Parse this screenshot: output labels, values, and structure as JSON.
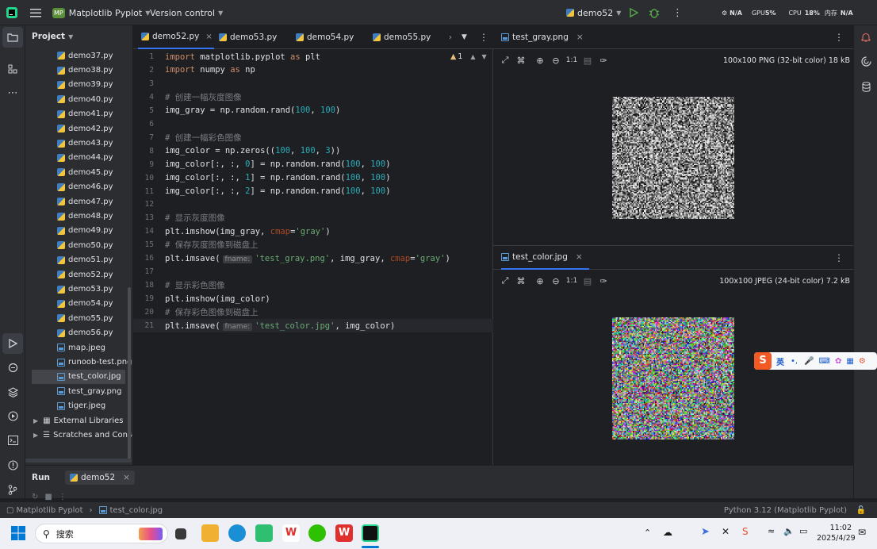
{
  "titlebar": {
    "project_badge": "MP",
    "project_name": "Matplotlib Pyplot",
    "vcs": "Version control",
    "run_config": "demo52",
    "monitor": {
      "net": "N/A",
      "gpu_label": "GPU",
      "gpu_value": "5%",
      "cpu_label": "CPU",
      "cpu_value": "18%",
      "mem_label": "内存",
      "mem_value": "N/A"
    }
  },
  "project_panel": {
    "title": "Project",
    "items": [
      {
        "label": "demo37.py",
        "type": "py"
      },
      {
        "label": "demo38.py",
        "type": "py"
      },
      {
        "label": "demo39.py",
        "type": "py"
      },
      {
        "label": "demo40.py",
        "type": "py"
      },
      {
        "label": "demo41.py",
        "type": "py"
      },
      {
        "label": "demo42.py",
        "type": "py"
      },
      {
        "label": "demo43.py",
        "type": "py"
      },
      {
        "label": "demo44.py",
        "type": "py"
      },
      {
        "label": "demo45.py",
        "type": "py"
      },
      {
        "label": "demo46.py",
        "type": "py"
      },
      {
        "label": "demo47.py",
        "type": "py"
      },
      {
        "label": "demo48.py",
        "type": "py"
      },
      {
        "label": "demo49.py",
        "type": "py"
      },
      {
        "label": "demo50.py",
        "type": "py"
      },
      {
        "label": "demo51.py",
        "type": "py"
      },
      {
        "label": "demo52.py",
        "type": "py"
      },
      {
        "label": "demo53.py",
        "type": "py"
      },
      {
        "label": "demo54.py",
        "type": "py"
      },
      {
        "label": "demo55.py",
        "type": "py"
      },
      {
        "label": "demo56.py",
        "type": "py"
      },
      {
        "label": "map.jpeg",
        "type": "img"
      },
      {
        "label": "runoob-test.png",
        "type": "img"
      },
      {
        "label": "test_color.jpg",
        "type": "img",
        "selected": true
      },
      {
        "label": "test_gray.png",
        "type": "img"
      },
      {
        "label": "tiger.jpeg",
        "type": "img"
      }
    ],
    "external_libraries": "External Libraries",
    "scratches": "Scratches and Consoles"
  },
  "editor": {
    "tabs": [
      "demo52.py",
      "demo53.py",
      "demo54.py",
      "demo55.py"
    ],
    "active_tab": "demo52.py",
    "warning_count": "1",
    "lines": [
      {
        "n": "1",
        "text": "import matplotlib.pyplot as plt"
      },
      {
        "n": "2",
        "text": "import numpy as np"
      },
      {
        "n": "3",
        "text": ""
      },
      {
        "n": "4",
        "text": "# 创建一幅灰度图像"
      },
      {
        "n": "5",
        "text": "img_gray = np.random.rand(100, 100)"
      },
      {
        "n": "6",
        "text": ""
      },
      {
        "n": "7",
        "text": "# 创建一幅彩色图像"
      },
      {
        "n": "8",
        "text": "img_color = np.zeros((100, 100, 3))"
      },
      {
        "n": "9",
        "text": "img_color[:, :, 0] = np.random.rand(100, 100)"
      },
      {
        "n": "10",
        "text": "img_color[:, :, 1] = np.random.rand(100, 100)"
      },
      {
        "n": "11",
        "text": "img_color[:, :, 2] = np.random.rand(100, 100)"
      },
      {
        "n": "12",
        "text": ""
      },
      {
        "n": "13",
        "text": "# 显示灰度图像"
      },
      {
        "n": "14",
        "text": "plt.imshow(img_gray, cmap='gray')"
      },
      {
        "n": "15",
        "text": "# 保存灰度图像到磁盘上"
      },
      {
        "n": "16",
        "text": "plt.imsave( fname: 'test_gray.png', img_gray, cmap='gray')"
      },
      {
        "n": "17",
        "text": ""
      },
      {
        "n": "18",
        "text": "# 显示彩色图像"
      },
      {
        "n": "19",
        "text": "plt.imshow(img_color)"
      },
      {
        "n": "20",
        "text": "# 保存彩色图像到磁盘上"
      },
      {
        "n": "21",
        "text": "plt.imsave( fname: 'test_color.jpg', img_color)"
      }
    ]
  },
  "image_viewers": [
    {
      "tab": "test_gray.png",
      "info": "100x100 PNG (32-bit color) 18 kB",
      "zoom_label": "1:1",
      "kind": "gray"
    },
    {
      "tab": "test_color.jpg",
      "info": "100x100 JPEG (24-bit color) 7.2 kB",
      "zoom_label": "1:1",
      "kind": "color"
    }
  ],
  "run_panel": {
    "title": "Run",
    "config_tab": "demo52"
  },
  "status": {
    "breadcrumb_project": "Matplotlib Pyplot",
    "breadcrumb_file": "test_color.jpg",
    "interpreter": "Python 3.12 (Matplotlib Pyplot)"
  },
  "ime": {
    "lang": "英"
  },
  "taskbar": {
    "search_placeholder": "搜索",
    "time": "11:02",
    "date": "2025/4/29"
  },
  "colors": {
    "accent": "#3574f0",
    "bg": "#1e1f22",
    "panel": "#2b2d30"
  }
}
